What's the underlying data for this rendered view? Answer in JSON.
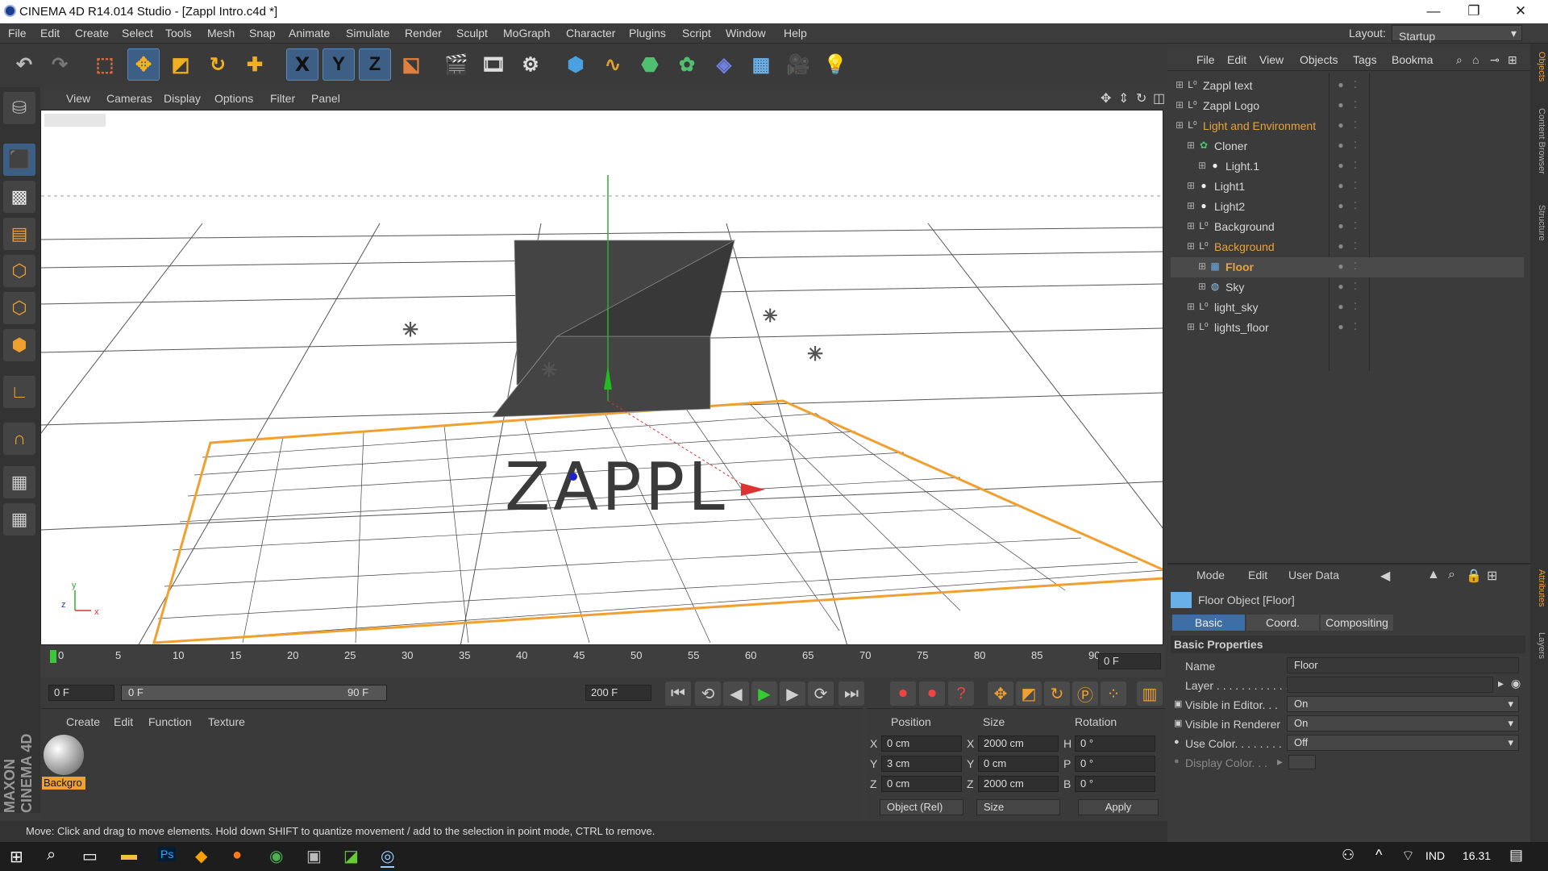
{
  "titlebar": {
    "title": "CINEMA 4D R14.014 Studio - [Zappl Intro.c4d *]",
    "minimize": "—",
    "restore": "❐",
    "close": "✕"
  },
  "menubar": {
    "items": [
      "File",
      "Edit",
      "Create",
      "Select",
      "Tools",
      "Mesh",
      "Snap",
      "Animate",
      "Simulate",
      "Render",
      "Sculpt",
      "MoGraph",
      "Character",
      "Plugins",
      "Script",
      "Window",
      "Help"
    ],
    "layout_label": "Layout:",
    "layout_value": "Startup"
  },
  "toolbar": {
    "icons": [
      "undo-icon",
      "redo-icon",
      "live-selection-icon",
      "move-icon",
      "scale-icon",
      "rotate-icon",
      "recent-tools-icon",
      "x-axis-icon",
      "y-axis-icon",
      "z-axis-icon",
      "coordinate-system-icon",
      "render-view-icon",
      "render-picture-viewer-icon",
      "edit-render-settings-icon",
      "cube-icon",
      "spline-icon",
      "nurbs-icon",
      "array-icon",
      "deformer-icon",
      "floor-icon",
      "camera-icon",
      "light-icon"
    ],
    "axis_labels": [
      "X",
      "Y",
      "Z"
    ]
  },
  "viewport": {
    "menu": [
      "View",
      "Cameras",
      "Display",
      "Options",
      "Filter",
      "Panel"
    ],
    "axis_y": "y",
    "axis_z": "z",
    "axis_x": "x",
    "logo_text": "ZAPPL"
  },
  "timeline": {
    "ticks": [
      "0",
      "5",
      "10",
      "15",
      "20",
      "25",
      "30",
      "35",
      "40",
      "45",
      "50",
      "55",
      "60",
      "65",
      "70",
      "75",
      "80",
      "85",
      "90"
    ],
    "current_frame": "0 F",
    "start_frame": "0 F",
    "range_start": "0 F",
    "range_end": "90 F",
    "end_frame": "200 F"
  },
  "material_manager": {
    "menu": [
      "Create",
      "Edit",
      "Function",
      "Texture"
    ],
    "materials": [
      {
        "name": "Backgro"
      }
    ]
  },
  "coordinates": {
    "headers": [
      "Position",
      "Size",
      "Rotation"
    ],
    "position": [
      {
        "axis": "X",
        "value": "0 cm"
      },
      {
        "axis": "Y",
        "value": "3 cm"
      },
      {
        "axis": "Z",
        "value": "0 cm"
      }
    ],
    "size": [
      {
        "axis": "X",
        "value": "2000 cm"
      },
      {
        "axis": "Y",
        "value": "0 cm"
      },
      {
        "axis": "Z",
        "value": "2000 cm"
      }
    ],
    "rotation": [
      {
        "axis": "H",
        "value": "0 °"
      },
      {
        "axis": "P",
        "value": "0 °"
      },
      {
        "axis": "B",
        "value": "0 °"
      }
    ],
    "mode": "Object (Rel)",
    "size_mode": "Size",
    "apply": "Apply"
  },
  "statusbar": {
    "text": "Move: Click and drag to move elements. Hold down SHIFT to quantize movement / add to the selection in point mode, CTRL to remove."
  },
  "object_manager": {
    "menu": [
      "File",
      "Edit",
      "View",
      "Objects",
      "Tags",
      "Bookma"
    ],
    "objects": [
      {
        "name": "Zappl text",
        "indent": 0,
        "highlight": false,
        "icon": "null-icon"
      },
      {
        "name": "Zappl Logo",
        "indent": 0,
        "highlight": false,
        "icon": "null-icon"
      },
      {
        "name": "Light and Environment",
        "indent": 0,
        "highlight": true,
        "icon": "null-icon"
      },
      {
        "name": "Cloner",
        "indent": 1,
        "highlight": false,
        "icon": "cloner-icon"
      },
      {
        "name": "Light.1",
        "indent": 2,
        "highlight": false,
        "icon": "light-icon"
      },
      {
        "name": "Light1",
        "indent": 1,
        "highlight": false,
        "icon": "light-icon"
      },
      {
        "name": "Light2",
        "indent": 1,
        "highlight": false,
        "icon": "light-icon"
      },
      {
        "name": "Background",
        "indent": 1,
        "highlight": false,
        "icon": "null-icon"
      },
      {
        "name": "Background",
        "indent": 1,
        "highlight": true,
        "icon": "null-icon"
      },
      {
        "name": "Floor",
        "indent": 2,
        "highlight": true,
        "icon": "floor-icon"
      },
      {
        "name": "Sky",
        "indent": 2,
        "highlight": false,
        "icon": "sky-icon"
      },
      {
        "name": "light_sky",
        "indent": 1,
        "highlight": false,
        "icon": "null-icon"
      },
      {
        "name": "lights_floor",
        "indent": 1,
        "highlight": false,
        "icon": "null-icon"
      }
    ]
  },
  "attributes": {
    "menu": [
      "Mode",
      "Edit",
      "User Data"
    ],
    "object_title": "Floor Object [Floor]",
    "tabs": [
      "Basic",
      "Coord.",
      "Compositing"
    ],
    "section": "Basic Properties",
    "name_label": "Name",
    "name_value": "Floor",
    "layer_label": "Layer . . . . . . . . . . . .",
    "visible_editor_label": "Visible in Editor. . .",
    "visible_editor_value": "On",
    "visible_renderer_label": "Visible in Renderer",
    "visible_renderer_value": "On",
    "use_color_label": "Use Color. . . . . . . .",
    "use_color_value": "Off",
    "display_color_label": "Display Color. . ."
  },
  "right_tabs": [
    "Objects",
    "Content Browser",
    "Structure",
    "Attributes",
    "Layers"
  ],
  "taskbar": {
    "language": "IND",
    "time": "16.31"
  },
  "colors": {
    "accent_orange": "#f0a030",
    "selection_blue": "#3d5f86",
    "highlight_orange": "#e8a33a"
  }
}
